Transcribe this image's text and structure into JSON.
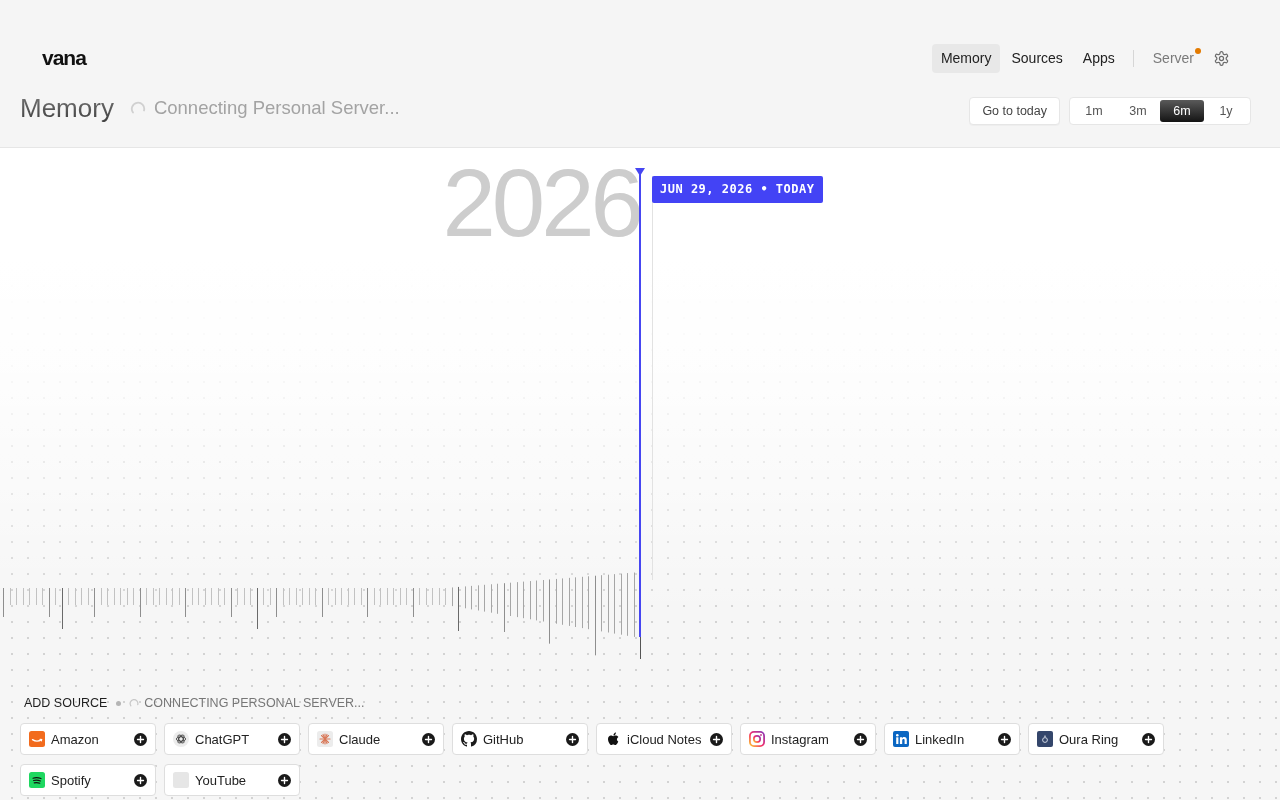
{
  "header": {
    "logo": "vana",
    "nav": [
      {
        "label": "Memory",
        "selected": true
      },
      {
        "label": "Sources",
        "selected": false
      },
      {
        "label": "Apps",
        "selected": false
      }
    ],
    "server": {
      "label": "Server",
      "notification": true
    }
  },
  "toolbar": {
    "title": "Memory",
    "status": {
      "text": "Connecting Personal Server...",
      "loading": true
    },
    "today_button": "Go to today",
    "ranges": [
      {
        "label": "1m",
        "selected": false
      },
      {
        "label": "3m",
        "selected": false
      },
      {
        "label": "6m",
        "selected": true
      },
      {
        "label": "1y",
        "selected": false
      }
    ]
  },
  "timeline": {
    "year": "2026",
    "today_label": "JUN 29, 2026 • TODAY"
  },
  "add_source": {
    "heading": "ADD SOURCE",
    "status": {
      "text": "CONNECTING PERSONAL SERVER...",
      "loading": true
    },
    "sources": [
      {
        "name": "Amazon"
      },
      {
        "name": "ChatGPT"
      },
      {
        "name": "Claude"
      },
      {
        "name": "GitHub"
      },
      {
        "name": "iCloud Notes"
      },
      {
        "name": "Instagram"
      },
      {
        "name": "LinkedIn"
      },
      {
        "name": "Oura Ring"
      },
      {
        "name": "Spotify"
      },
      {
        "name": "YouTube"
      }
    ]
  }
}
